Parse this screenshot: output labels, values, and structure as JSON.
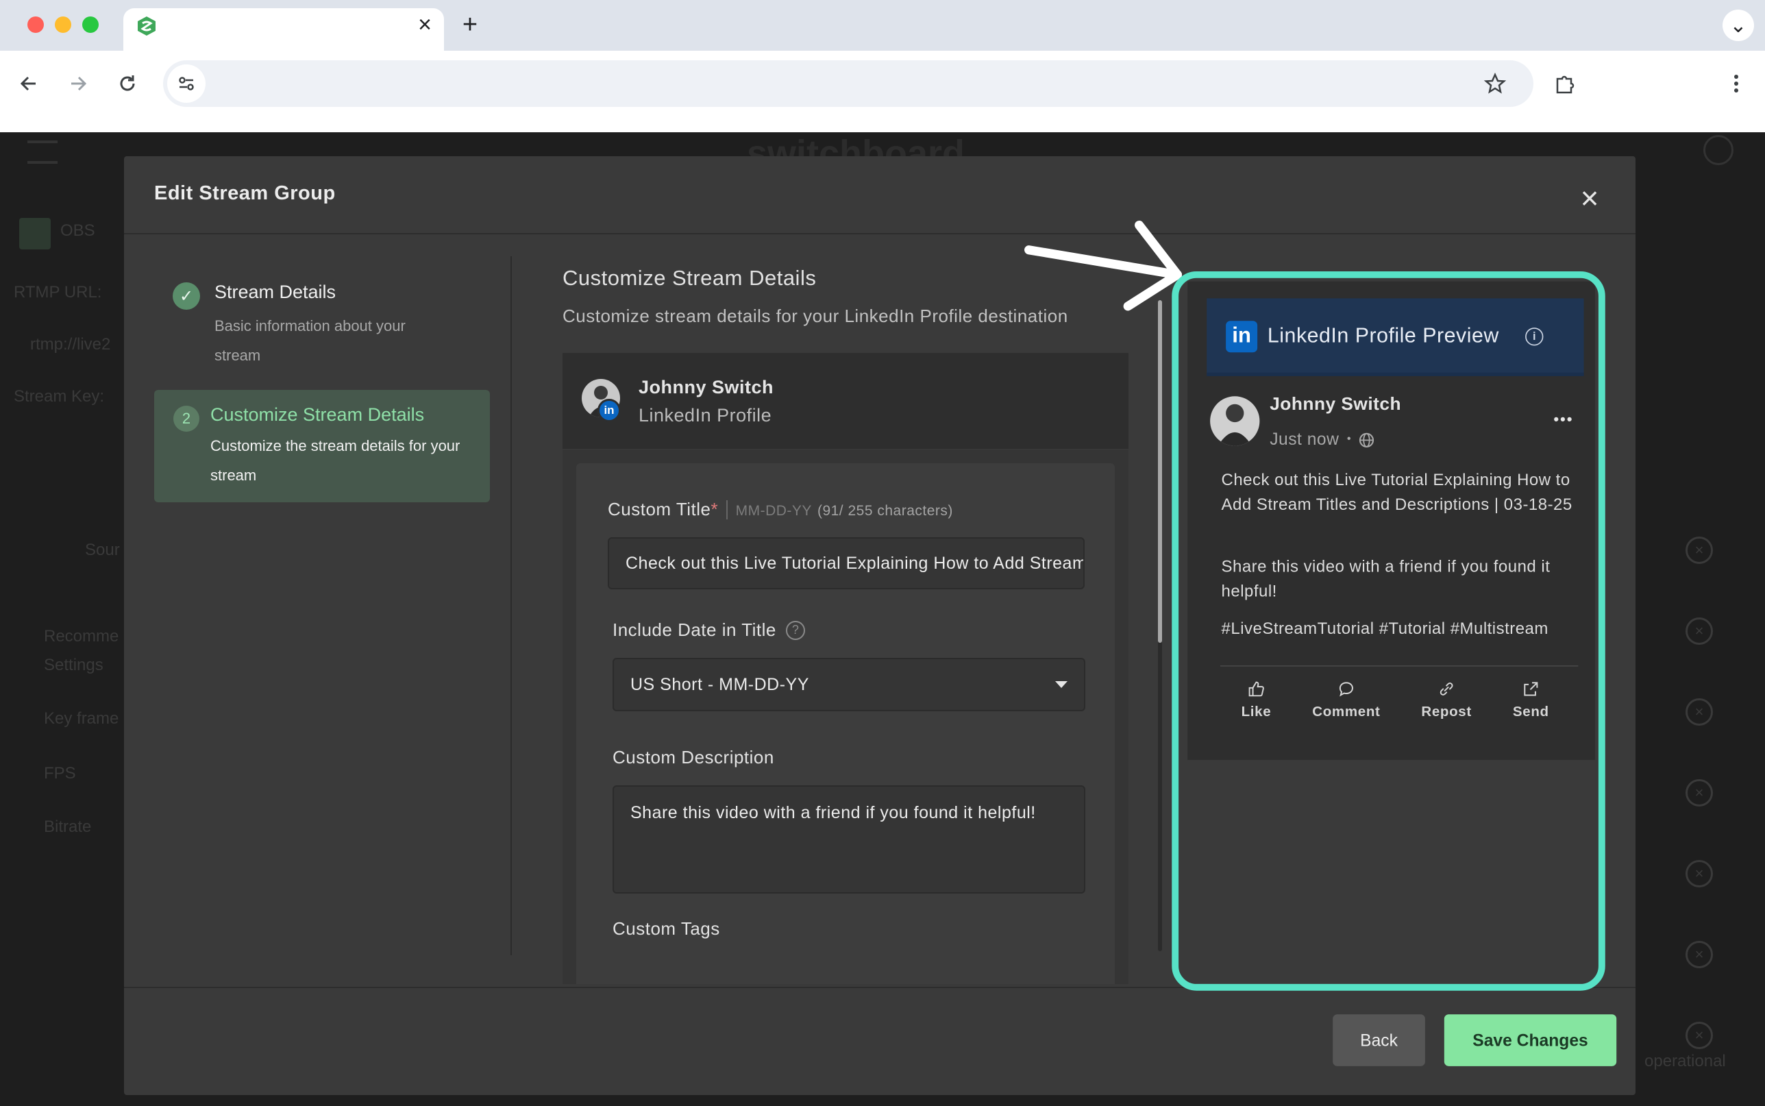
{
  "browser": {
    "tab_close": "×",
    "new_tab": "+",
    "tab_search": "⌄"
  },
  "modal": {
    "title": "Edit Stream Group",
    "close": "×"
  },
  "steps": [
    {
      "number": "✓",
      "title": "Stream Details",
      "description": "Basic information about your stream",
      "state": "complete"
    },
    {
      "number": "2",
      "title": "Customize Stream Details",
      "description": "Customize the stream details for your stream",
      "state": "active"
    }
  ],
  "form": {
    "heading": "Customize Stream Details",
    "subheading": "Customize stream details for your LinkedIn Profile destination",
    "profile": {
      "name": "Johnny Switch",
      "type": "LinkedIn Profile",
      "badge": "in"
    },
    "custom_title": {
      "label": "Custom Title",
      "required_mark": "*",
      "format_hint": "MM-DD-YY",
      "char_count": "(91/ 255 characters)",
      "value": "Check out this Live Tutorial Explaining How to Add Stream Titles and Descriptions"
    },
    "include_date": {
      "label": "Include Date in Title",
      "help_icon": "?",
      "selected": "US Short - MM-DD-YY"
    },
    "custom_description": {
      "label": "Custom Description",
      "value": "Share this video with a friend if you found it helpful!"
    },
    "custom_tags": {
      "label": "Custom Tags"
    }
  },
  "preview": {
    "logo": "in",
    "title": "LinkedIn Profile Preview",
    "info_icon": "i",
    "author": "Johnny Switch",
    "time": "Just now",
    "separator": "•",
    "more": "•••",
    "post_title": "Check out this Live Tutorial Explaining How to Add Stream Titles and Descriptions | 03-18-25",
    "post_description": "Share this video with a friend if you found it helpful!",
    "hashtags": "#LiveStreamTutorial #Tutorial #Multistream",
    "actions": [
      "Like",
      "Comment",
      "Repost",
      "Send"
    ],
    "outline_color": "#57e2c6"
  },
  "footer": {
    "back": "Back",
    "save": "Save Changes"
  },
  "background_app": {
    "labels": [
      "OBS",
      "RTMP URL:",
      "rtmp://live2",
      "Stream Key:",
      "Sour",
      "Recomme",
      "Settings",
      "Key frame",
      "FPS",
      "Bitrate",
      "operational"
    ]
  },
  "colors": {
    "accent_green": "#85e5a0",
    "linkedin_blue": "#0a66c2",
    "modal_bg": "#3a3a3a"
  }
}
